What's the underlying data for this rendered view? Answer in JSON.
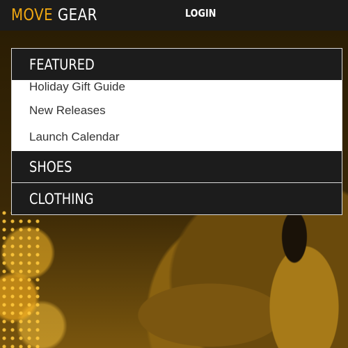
{
  "header": {
    "logo_part1": "MOVE",
    "logo_part2": "GEAR",
    "login_label": "LOGIN"
  },
  "menu": {
    "sections": [
      {
        "label": "FEATURED",
        "expanded": true,
        "items": [
          "Holiday Gift Guide",
          "New Releases",
          "Launch Calendar"
        ]
      },
      {
        "label": "SHOES",
        "expanded": false
      },
      {
        "label": "CLOTHING",
        "expanded": false
      }
    ]
  },
  "colors": {
    "accent": "#f0a812",
    "bar": "#1c1c1c",
    "panel_text": "#333333"
  }
}
